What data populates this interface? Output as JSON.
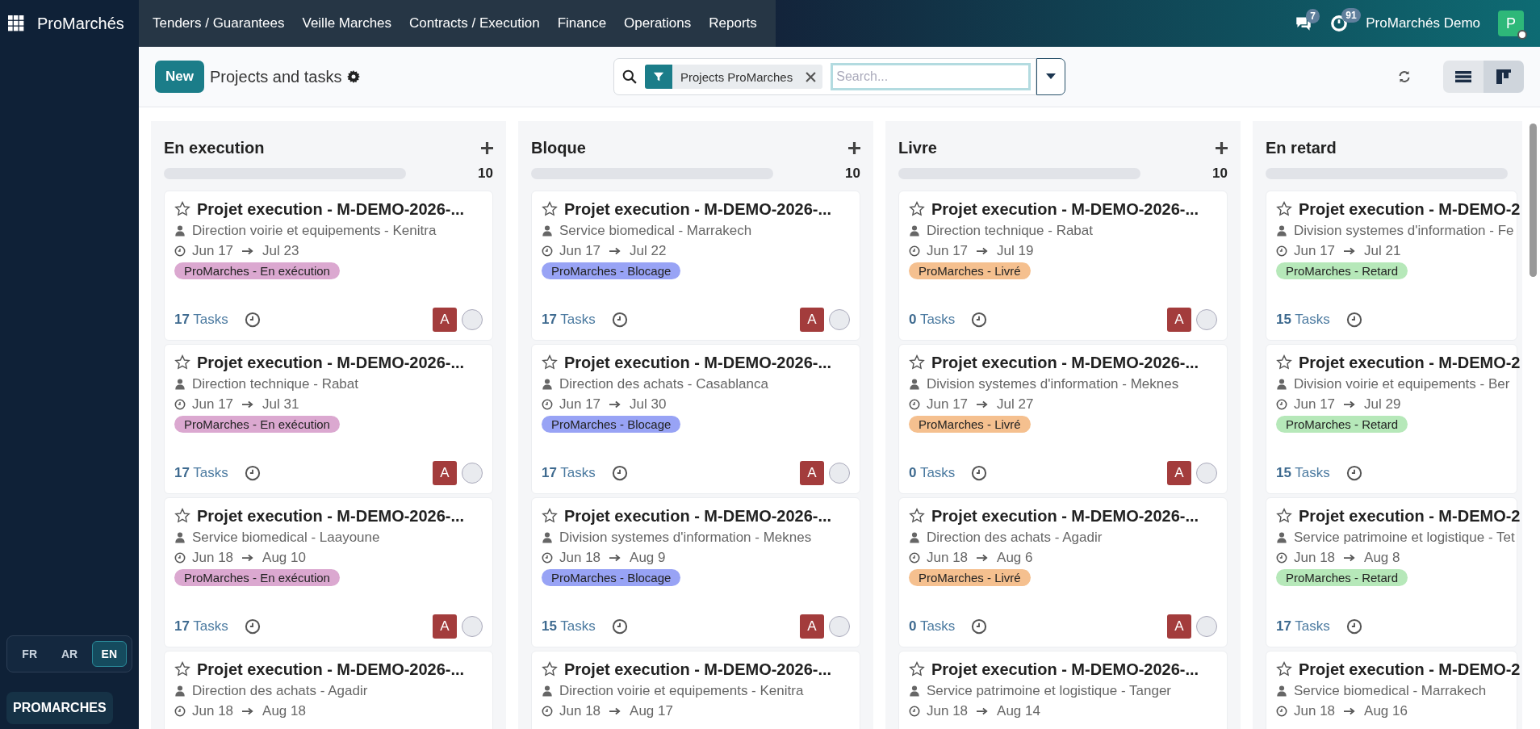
{
  "topbar": {
    "brand": "ProMarchés",
    "menu": [
      "Tenders / Guarantees",
      "Veille Marches",
      "Contracts / Execution",
      "Finance",
      "Operations",
      "Reports"
    ],
    "messages_count": "7",
    "activities_count": "91",
    "user_name": "ProMarchés Demo",
    "user_initial": "P"
  },
  "sidebar": {
    "languages": [
      {
        "label": "FR",
        "selected": false
      },
      {
        "label": "AR",
        "selected": false
      },
      {
        "label": "EN",
        "selected": true
      }
    ],
    "footer_button": "PROMARCHES"
  },
  "control_panel": {
    "new_button": "New",
    "title": "Projects and tasks",
    "filter": "Projects ProMarches",
    "search": {
      "placeholder": "Search..."
    },
    "views": [
      {
        "kind": "list",
        "selected": false
      },
      {
        "kind": "kanban",
        "selected": true
      }
    ]
  },
  "columns": [
    {
      "title": "En execution",
      "count": "10",
      "level": 0,
      "cards": [
        {
          "title": "Projet execution - M-DEMO-2026-...",
          "owner": "Direction voirie et equipements - Kenitra",
          "start": "Jun 17",
          "end": "Jul 23",
          "tag": "ProMarches - En exécution",
          "color": "#dba8d0",
          "tasks": "**17** Tasks",
          "avatar": "A"
        },
        {
          "title": "Projet execution - M-DEMO-2026-...",
          "owner": "Direction technique - Rabat",
          "start": "Jun 17",
          "end": "Jul 31",
          "tag": "ProMarches - En exécution",
          "color": "#dba8d0",
          "tasks": "**17** Tasks",
          "avatar": "A"
        },
        {
          "title": "Projet execution - M-DEMO-2026-...",
          "owner": "Service biomedical - Laayoune",
          "start": "Jun 18",
          "end": "Aug 10",
          "tag": "ProMarches - En exécution",
          "color": "#dba8d0",
          "tasks": "**17** Tasks",
          "avatar": "A"
        },
        {
          "title": "Projet execution - M-DEMO-2026-...",
          "owner": "Direction des achats - Agadir",
          "start": "Jun 18",
          "end": "Aug 18"
        }
      ]
    },
    {
      "title": "Bloque",
      "count": "10",
      "level": 0,
      "cards": [
        {
          "title": "Projet execution - M-DEMO-2026-...",
          "owner": "Service biomedical - Marrakech",
          "start": "Jun 17",
          "end": "Jul 22",
          "tag": "ProMarches - Blocage",
          "color": "#98a3f5",
          "tasks": "**17** Tasks",
          "avatar": "A"
        },
        {
          "title": "Projet execution - M-DEMO-2026-...",
          "owner": "Direction des achats - Casablanca",
          "start": "Jun 17",
          "end": "Jul 30",
          "tag": "ProMarches - Blocage",
          "color": "#98a3f5",
          "tasks": "**17** Tasks",
          "avatar": "A"
        },
        {
          "title": "Projet execution - M-DEMO-2026-...",
          "owner": "Division systemes d'information - Meknes",
          "start": "Jun 18",
          "end": "Aug 9",
          "tag": "ProMarches - Blocage",
          "color": "#98a3f5",
          "tasks": "**15** Tasks",
          "avatar": "A"
        },
        {
          "title": "Projet execution - M-DEMO-2026-...",
          "owner": "Direction voirie et equipements - Kenitra",
          "start": "Jun 18",
          "end": "Aug 17"
        }
      ]
    },
    {
      "title": "Livre",
      "count": "10",
      "level": 0,
      "cards": [
        {
          "title": "Projet execution - M-DEMO-2026-...",
          "owner": "Direction technique - Rabat",
          "start": "Jun 17",
          "end": "Jul 19",
          "tag": "ProMarches - Livré",
          "color": "#f5c08f",
          "tasks": "**0** Tasks",
          "avatar": "A"
        },
        {
          "title": "Projet execution - M-DEMO-2026-...",
          "owner": "Division systemes d'information - Meknes",
          "start": "Jun 17",
          "end": "Jul 27",
          "tag": "ProMarches - Livré",
          "color": "#f5c08f",
          "tasks": "**0** Tasks",
          "avatar": "A"
        },
        {
          "title": "Projet execution - M-DEMO-2026-...",
          "owner": "Direction des achats - Agadir",
          "start": "Jun 18",
          "end": "Aug 6",
          "tag": "ProMarches - Livré",
          "color": "#f5c08f",
          "tasks": "**0** Tasks",
          "avatar": "A"
        },
        {
          "title": "Projet execution - M-DEMO-2026-...",
          "owner": "Service patrimoine et logistique - Tanger",
          "start": "Jun 18",
          "end": "Aug 14"
        }
      ]
    },
    {
      "title": "En retard",
      "level": 0,
      "cards": [
        {
          "title": "Projet execution - M-DEMO-2",
          "owner": "Division systemes d'information - Fe",
          "start": "Jun 17",
          "end": "Jul 21",
          "tag": "ProMarches - Retard",
          "color": "#b6e8b9",
          "tasks": "**15** Tasks"
        },
        {
          "title": "Projet execution - M-DEMO-2",
          "owner": "Division voirie et equipements - Ber",
          "start": "Jun 17",
          "end": "Jul 29",
          "tag": "ProMarches - Retard",
          "color": "#b6e8b9",
          "tasks": "**15** Tasks"
        },
        {
          "title": "Projet execution - M-DEMO-2",
          "owner": "Service patrimoine et logistique - Tet",
          "start": "Jun 18",
          "end": "Aug 8",
          "tag": "ProMarches - Retard",
          "color": "#b6e8b9",
          "tasks": "**17** Tasks"
        },
        {
          "title": "Projet execution - M-DEMO-2",
          "owner": "Service biomedical - Marrakech",
          "start": "Jun 18",
          "end": "Aug 16"
        }
      ]
    }
  ]
}
